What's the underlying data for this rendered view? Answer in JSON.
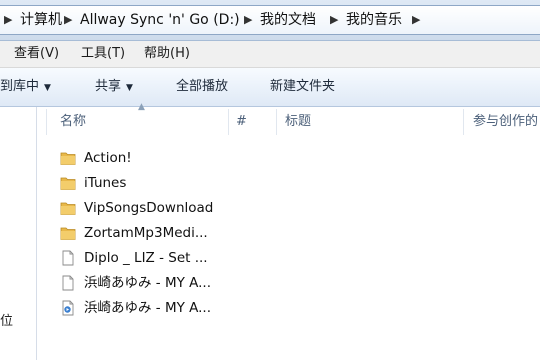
{
  "address": {
    "crumbs": [
      "计算机",
      "Allway Sync 'n' Go (D:)",
      "我的文档",
      "我的音乐"
    ]
  },
  "menu": {
    "view": "查看(V)",
    "tools": "工具(T)",
    "help": "帮助(H)"
  },
  "toolbar": {
    "add_to_library": "到库中",
    "share": "共享",
    "play_all": "全部播放",
    "new_folder": "新建文件夹"
  },
  "nav": {
    "partial_label": "位"
  },
  "columns": {
    "name": "名称",
    "number": "#",
    "title": "标题",
    "contributing_artist": "参与创作的"
  },
  "files": [
    {
      "name": "Action!",
      "icon": "folder-icon"
    },
    {
      "name": "iTunes",
      "icon": "folder-icon"
    },
    {
      "name": "VipSongsDownload",
      "icon": "folder-icon"
    },
    {
      "name": "ZortamMp3Medi...",
      "icon": "folder-icon"
    },
    {
      "name": "Diplo _ LIZ - Set ...",
      "icon": "file-icon"
    },
    {
      "name": "浜崎あゆみ - MY A...",
      "icon": "file-icon"
    },
    {
      "name": "浜崎あゆみ - MY A...",
      "icon": "media-file-icon"
    }
  ],
  "colors": {
    "folder": "#e8b84a",
    "header_text": "#4c607a",
    "accent": "#1a5fb4"
  }
}
